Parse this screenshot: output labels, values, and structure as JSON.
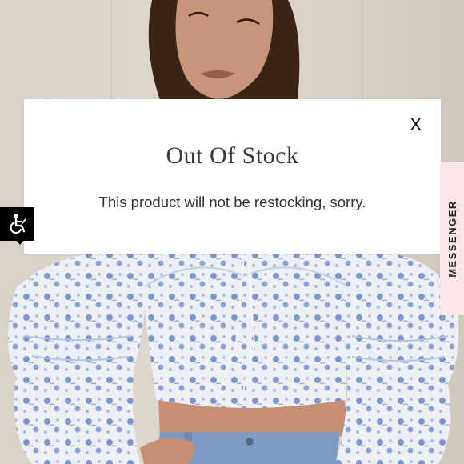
{
  "modal": {
    "close_label": "X",
    "title": "Out Of Stock",
    "message": "This product will not be restocking, sorry."
  },
  "messenger": {
    "label": "MESSENGER",
    "background_color": "#fbe6ea"
  },
  "accessibility": {
    "icon": "wheelchair-icon",
    "background_color": "#000000"
  },
  "product_photo": {
    "icon": "product-photo-floral-top"
  }
}
